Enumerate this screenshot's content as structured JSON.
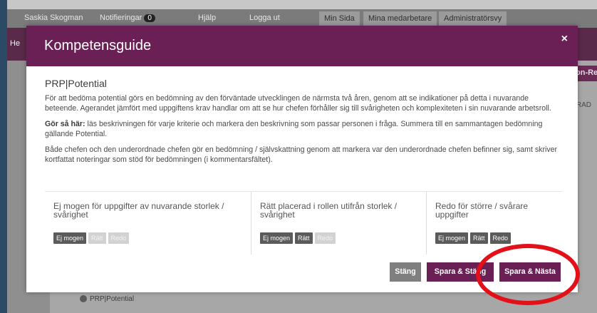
{
  "background": {
    "user_name": "Saskia Skogman",
    "notifications_label": "Notifieringar",
    "notifications_count": "0",
    "help_label": "Hjälp",
    "logout_label": "Logga ut",
    "tabs": [
      "Min Sida",
      "Mina medarbetare",
      "Administratörsvy"
    ],
    "header_fragment": "He",
    "right_button_fragment": "on-Re",
    "column_fragment": "RAD",
    "bottom_row_label": "PRP|Potential"
  },
  "modal": {
    "title": "Kompetensguide",
    "close_symbol": "×",
    "section_title": "PRP|Potential",
    "para1": "För att bedöma potential görs en bedömning av den förväntade utvecklingen de närmsta två åren, genom att se indikationer på detta i nuvarande beteende. Agerandet jämfört med uppgiftens krav handlar om att se hur chefen förhåller sig till svårigheten och komplexiteten i sin nuvarande arbetsroll.",
    "para2_bold": "Gör så här:",
    "para2": " läs beskrivningen för varje kriterie och markera den beskrivning som passar personen i fråga. Summera till en sammantagen bedömning gällande Potential.",
    "para3": "Både chefen och den underordnade chefen gör en bedömning / självskattning genom att markera var den underordnade chefen befinner sig, samt skriver kortfattat noteringar som stöd för bedömningen (i kommentarsfältet).",
    "options": [
      {
        "label": "Ej mogen för uppgifter av nuvarande storlek / svårighet",
        "pills": [
          "Ej mogen",
          "Rätt",
          "Redo"
        ],
        "active": [
          true,
          false,
          false
        ]
      },
      {
        "label": "Rätt placerad i rollen utifrån storlek / svårighet",
        "pills": [
          "Ej mogen",
          "Rätt",
          "Redo"
        ],
        "active": [
          true,
          true,
          false
        ]
      },
      {
        "label": "Redo för större / svårare uppgifter",
        "pills": [
          "Ej mogen",
          "Rätt",
          "Redo"
        ],
        "active": [
          true,
          true,
          true
        ]
      }
    ],
    "buttons": {
      "close": "Stäng",
      "save_close": "Spara & Stäng",
      "save_next": "Spara & Nästa"
    }
  },
  "colors": {
    "brand": "#6b2055",
    "annotation": "#e3101a"
  }
}
